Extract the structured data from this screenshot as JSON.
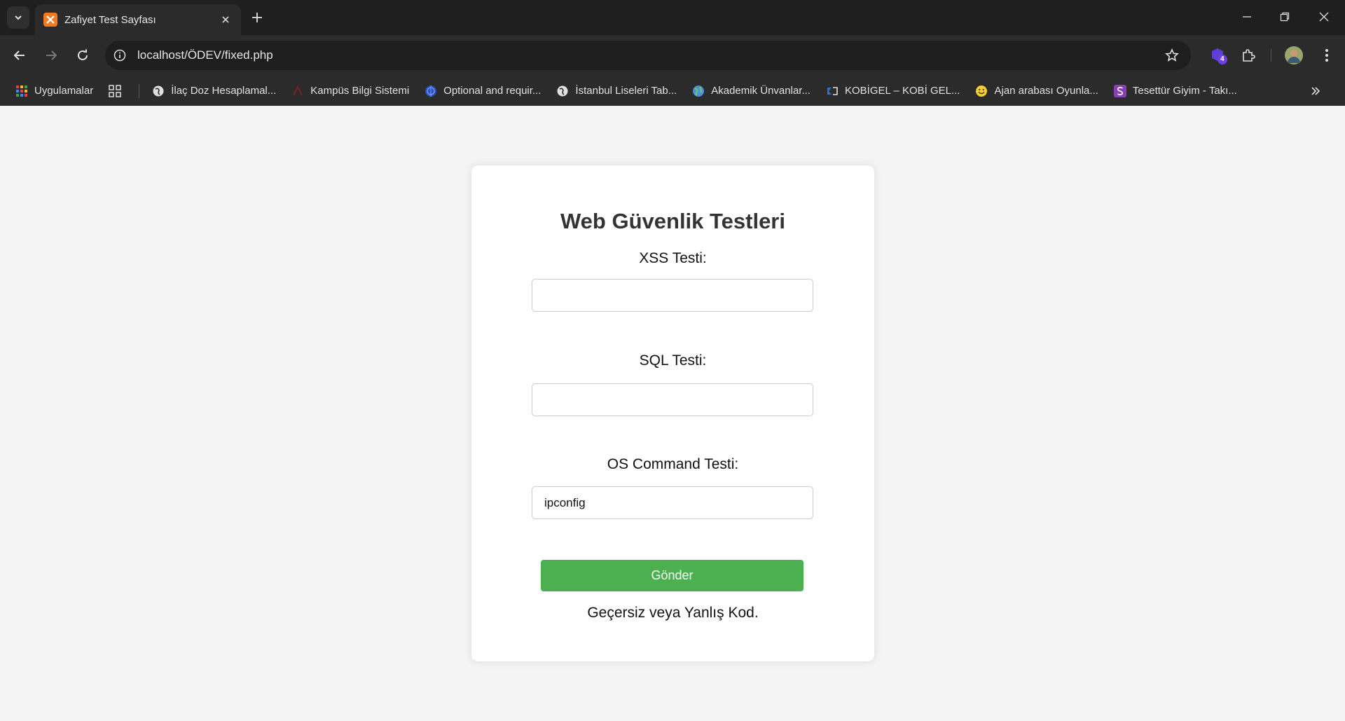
{
  "browser": {
    "tab_title": "Zafiyet Test Sayfası",
    "url": "localhost/ÖDEV/fixed.php",
    "extension_badge": "4",
    "bookmarks": [
      {
        "label": "Uygulamalar",
        "icon": "apps-grid-icon"
      },
      {
        "label": "İlaç Doz Hesaplamal...",
        "icon": "globe-icon"
      },
      {
        "label": "Kampüs Bilgi Sistemi",
        "icon": "university-logo-icon"
      },
      {
        "label": "Optional and requir...",
        "icon": "circle-logo-icon"
      },
      {
        "label": "İstanbul Liseleri Tab...",
        "icon": "globe-icon"
      },
      {
        "label": "Akademik Ünvanlar...",
        "icon": "earth-icon"
      },
      {
        "label": "KOBİGEL – KOBİ GEL...",
        "icon": "kobigel-logo-icon"
      },
      {
        "label": "Ajan arabası Oyunla...",
        "icon": "smiley-icon"
      },
      {
        "label": "Tesettür Giyim - Takı...",
        "icon": "s-logo-icon"
      }
    ]
  },
  "page": {
    "title": "Web Güvenlik Testleri",
    "xss_label": "XSS Testi:",
    "xss_value": "",
    "sql_label": "SQL Testi:",
    "sql_value": "",
    "os_label": "OS Command Testi:",
    "os_value": "ipconfig",
    "submit_label": "Gönder",
    "result": "Geçersiz veya Yanlış Kod."
  },
  "colors": {
    "accent": "#4caf50",
    "page_bg": "#f4f4f4",
    "chrome_bg": "#2b2b2b"
  }
}
